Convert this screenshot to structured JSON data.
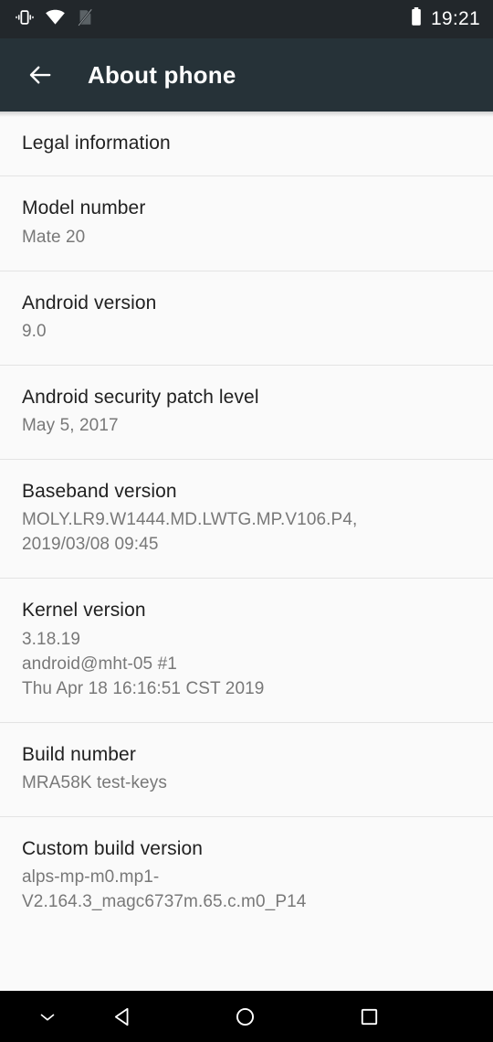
{
  "status_bar": {
    "time": "19:21",
    "icons": [
      {
        "name": "vibrate-icon",
        "label": "Vibrate mode"
      },
      {
        "name": "wifi-icon",
        "label": "Wi-Fi connected"
      },
      {
        "name": "no-sim-icon",
        "label": "No SIM card"
      }
    ],
    "battery": {
      "name": "battery-icon",
      "label": "Battery"
    },
    "background_color": "#22272b",
    "foreground_color": "#ffffff"
  },
  "app_bar": {
    "title": "About phone",
    "back_label": "Navigate up",
    "background_color": "#263238",
    "title_color": "#ffffff"
  },
  "list": {
    "background_color": "#fafafa",
    "divider_color": "#e3e3e3",
    "title_color": "#212121",
    "subtitle_color": "#787878",
    "items": [
      {
        "title": "Legal information",
        "subtitle": ""
      },
      {
        "title": "Model number",
        "subtitle": "Mate 20"
      },
      {
        "title": "Android version",
        "subtitle": "9.0"
      },
      {
        "title": "Android security patch level",
        "subtitle": "May 5, 2017"
      },
      {
        "title": "Baseband version",
        "subtitle": "MOLY.LR9.W1444.MD.LWTG.MP.V106.P4, 2019/03/08 09:45"
      },
      {
        "title": "Kernel version",
        "subtitle": "3.18.19\nandroid@mht-05 #1\nThu Apr 18 16:16:51 CST 2019"
      },
      {
        "title": "Build number",
        "subtitle": "MRA58K test-keys"
      },
      {
        "title": "Custom build version",
        "subtitle": "alps-mp-m0.mp1-V2.164.3_magc6737m.65.c.m0_P14"
      }
    ]
  },
  "nav_bar": {
    "background_color": "#000000",
    "buttons": [
      {
        "name": "hide-keyboard-icon",
        "label": "Hide"
      },
      {
        "name": "back-triangle-icon",
        "label": "Back"
      },
      {
        "name": "home-circle-icon",
        "label": "Home"
      },
      {
        "name": "recents-square-icon",
        "label": "Recents"
      }
    ]
  }
}
